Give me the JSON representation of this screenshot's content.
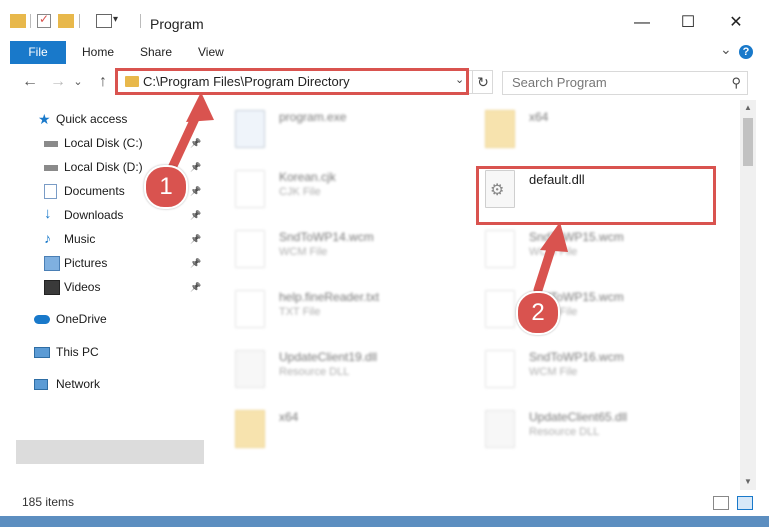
{
  "window": {
    "title": "Program",
    "minimize_glyph": "—",
    "maximize_glyph": "☐",
    "close_glyph": "✕"
  },
  "ribbon": {
    "file": "File",
    "home": "Home",
    "share": "Share",
    "view": "View",
    "expand_glyph": "⌄",
    "help_glyph": "?"
  },
  "nav": {
    "back_glyph": "←",
    "forward_glyph": "→",
    "recent_glyph": "⌄",
    "up_glyph": "↑",
    "address": "C:\\Program Files\\Program Directory",
    "dropdown_glyph": "⌄",
    "refresh_glyph": "↻",
    "search_placeholder": "Search Program",
    "search_glyph": "⚲"
  },
  "sidebar": {
    "quick_access": "Quick access",
    "items": [
      {
        "label": "Local Disk (C:)",
        "icon": "drive-icon",
        "pinned": true
      },
      {
        "label": "Local Disk (D:)",
        "icon": "drive-icon",
        "pinned": true
      },
      {
        "label": "Documents",
        "icon": "documents-icon",
        "pinned": true
      },
      {
        "label": "Downloads",
        "icon": "downloads-icon",
        "pinned": true
      },
      {
        "label": "Music",
        "icon": "music-icon",
        "pinned": true
      },
      {
        "label": "Pictures",
        "icon": "pictures-icon",
        "pinned": true
      },
      {
        "label": "Videos",
        "icon": "videos-icon",
        "pinned": true
      }
    ],
    "pin_glyph": "📌",
    "onedrive": "OneDrive",
    "this_pc": "This PC",
    "network": "Network"
  },
  "files": {
    "left_column": [
      {
        "name": "program.exe",
        "type": "",
        "kind": "exe"
      },
      {
        "name": "Korean.cjk",
        "type": "CJK File",
        "kind": "doc"
      },
      {
        "name": "SndToWP14.wcm",
        "type": "WCM File",
        "kind": "doc"
      },
      {
        "name": "help.fineReader.txt",
        "type": "TXT File",
        "kind": "doc"
      },
      {
        "name": "UpdateClient19.dll",
        "type": "Resource DLL",
        "kind": "dll"
      },
      {
        "name": "x64",
        "type": "",
        "kind": "folder"
      }
    ],
    "right_column": [
      {
        "name": "x64",
        "type": "",
        "kind": "folder"
      },
      {
        "name": "default.dll",
        "type": "",
        "kind": "dll",
        "highlighted": true
      },
      {
        "name": "SndToWP15.wcm",
        "type": "WCM File",
        "kind": "doc"
      },
      {
        "name": "SndToWP15.wcm",
        "type": "WCM File",
        "kind": "doc"
      },
      {
        "name": "SndToWP16.wcm",
        "type": "WCM File",
        "kind": "doc"
      },
      {
        "name": "UpdateClient65.dll",
        "type": "Resource DLL",
        "kind": "dll"
      }
    ]
  },
  "status": {
    "count": "185 items"
  },
  "annotations": {
    "step1": "1",
    "step2": "2",
    "color": "#d9534f"
  }
}
